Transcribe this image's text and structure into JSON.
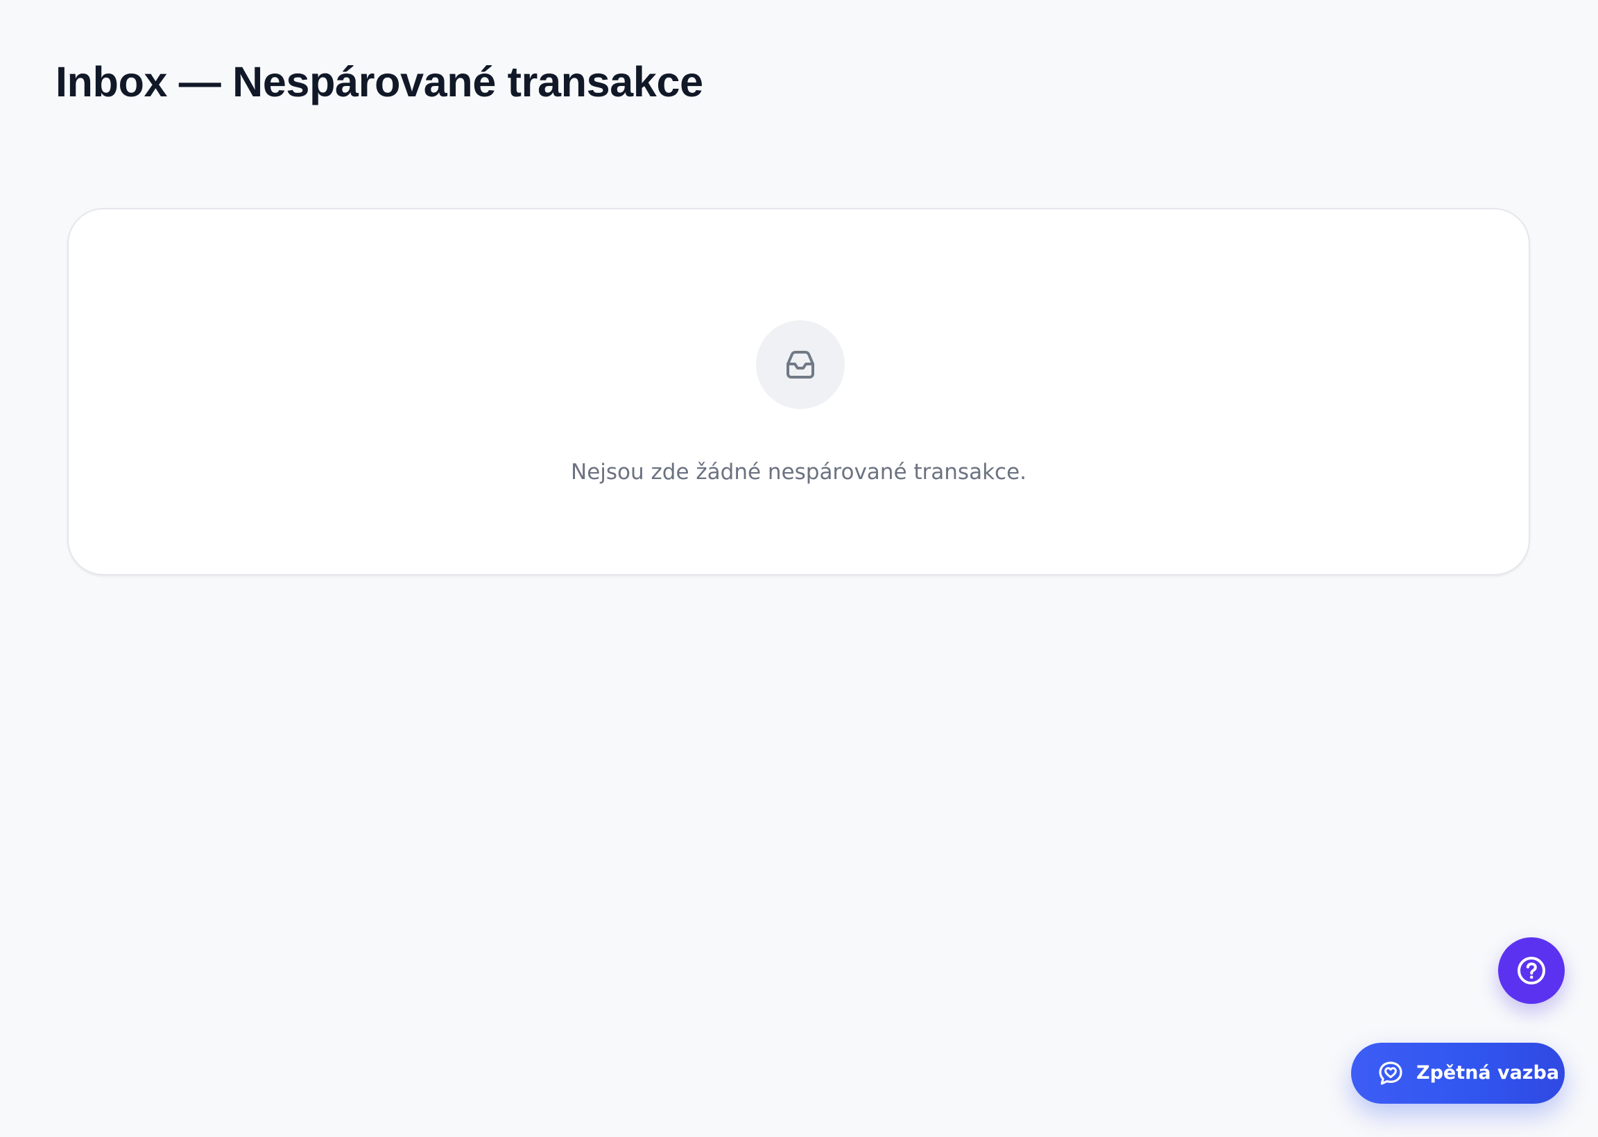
{
  "header": {
    "title": "Inbox — Nespárované transakce"
  },
  "empty_state": {
    "icon": "inbox-icon",
    "message": "Nejsou zde žádné nespárované transakce."
  },
  "floating_actions": {
    "help": {
      "icon": "question-circle-icon"
    },
    "feedback": {
      "icon": "heart-message-icon",
      "label": "Zpětná vazba"
    }
  },
  "colors": {
    "background": "#f8f9fb",
    "card": "#ffffff",
    "title": "#111827",
    "muted_text": "#6b7280",
    "help_button": "#5b32f0",
    "feedback_button": "#3156f0"
  }
}
